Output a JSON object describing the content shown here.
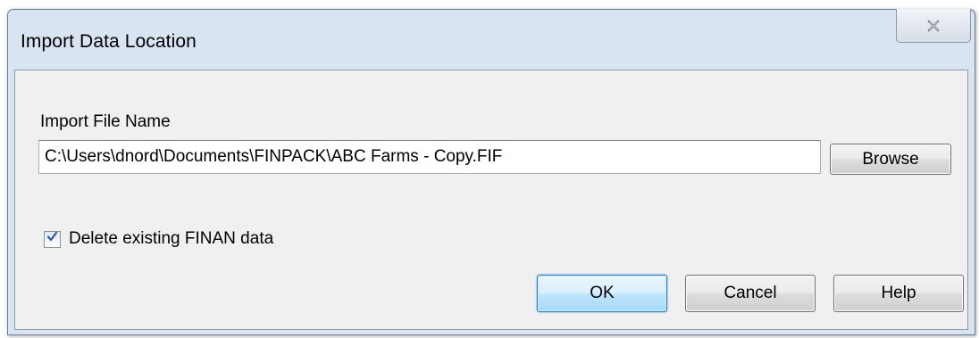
{
  "window": {
    "title": "Import Data Location"
  },
  "file": {
    "label": "Import File Name",
    "value": "C:\\Users\\dnord\\Documents\\FINPACK\\ABC Farms - Copy.FIF",
    "browse_label": "Browse"
  },
  "options": {
    "delete_label": "Delete existing FINAN data",
    "delete_checked": true
  },
  "buttons": {
    "ok_label": "OK",
    "cancel_label": "Cancel",
    "help_label": "Help"
  },
  "icons": {
    "close": "close-icon",
    "check": "checkmark-icon"
  },
  "colors": {
    "window_frame": "#d8e4f1",
    "client_bg": "#f0f0f0",
    "default_button_border": "#3c7fb1",
    "checkmark": "#2a5a9a"
  }
}
